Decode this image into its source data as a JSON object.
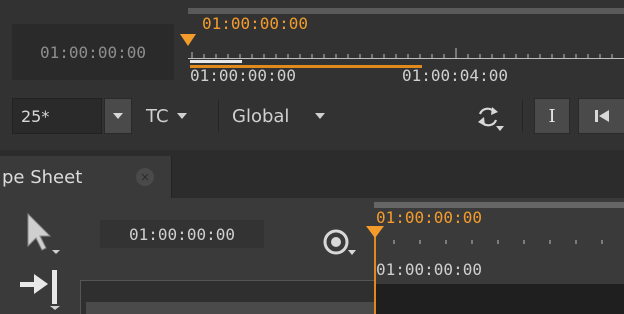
{
  "viewer": {
    "timecode_display": "01:00:00:00",
    "ruler_top_label": "01:00:00:00",
    "ruler_start_label": "01:00:00:00",
    "ruler_end_label": "01:00:04:00",
    "colors": {
      "accent": "#e08a1e",
      "playhead_label": "#f39c2b",
      "background": "#323232"
    }
  },
  "controls": {
    "fps_value": "25*",
    "timecode_mode": "TC",
    "scope": "Global",
    "icons": [
      "chevron-down-icon",
      "loop-icon",
      "in-point-icon",
      "skip-to-start-icon"
    ]
  },
  "dope_sheet": {
    "tab_label": "pe Sheet",
    "tab_close_glyph": "×",
    "timecode_field": "01:00:00:00",
    "ruler_top_label": "01:00:00:00",
    "ruler_bottom_label": "01:00:00:00",
    "icons": [
      "pointer-icon",
      "frame-cursor-icon",
      "step-in-icon"
    ]
  }
}
